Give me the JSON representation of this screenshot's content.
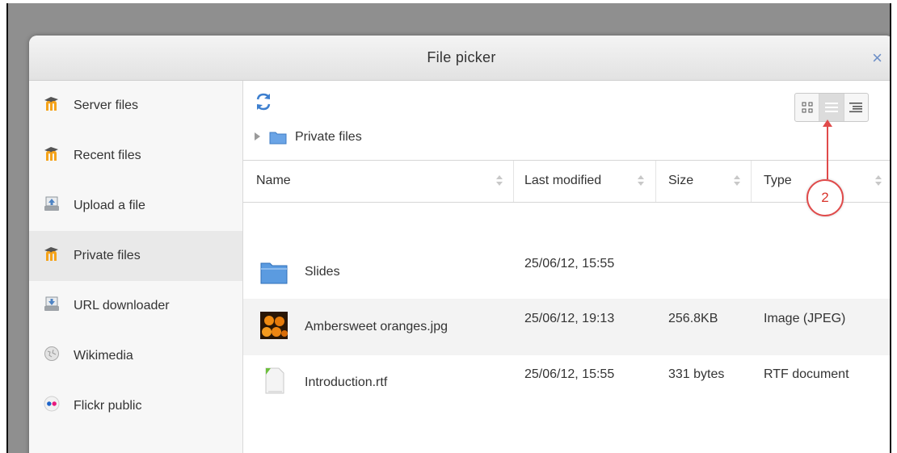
{
  "dialog": {
    "title": "File picker",
    "close_icon": "×"
  },
  "sidebar": {
    "items": [
      {
        "label": "Server files",
        "icon": "moodle-icon",
        "active": false
      },
      {
        "label": "Recent files",
        "icon": "moodle-icon",
        "active": false
      },
      {
        "label": "Upload a file",
        "icon": "upload-icon",
        "active": false
      },
      {
        "label": "Private files",
        "icon": "moodle-icon",
        "active": true
      },
      {
        "label": "URL downloader",
        "icon": "url-download-icon",
        "active": false
      },
      {
        "label": "Wikimedia",
        "icon": "wikimedia-icon",
        "active": false
      },
      {
        "label": "Flickr public",
        "icon": "flickr-icon",
        "active": false
      }
    ]
  },
  "toolbar": {
    "refresh_icon": "refresh-icon",
    "breadcrumb": "Private files",
    "view_modes": [
      "icons",
      "list",
      "tree"
    ],
    "active_view": "list"
  },
  "annotation": {
    "number": "2",
    "color": "#e04a4a"
  },
  "table": {
    "columns": [
      "Name",
      "Last modified",
      "Size",
      "Type"
    ],
    "rows": [
      {
        "name": "Slides",
        "modified": "25/06/12, 15:55",
        "size": "",
        "type": "",
        "icon": "folder-icon"
      },
      {
        "name": "Ambersweet oranges.jpg",
        "modified": "25/06/12, 19:13",
        "size": "256.8KB",
        "type": "Image (JPEG)",
        "icon": "image-thumbnail-icon"
      },
      {
        "name": "Introduction.rtf",
        "modified": "25/06/12, 15:55",
        "size": "331 bytes",
        "type": "RTF document",
        "icon": "document-icon"
      }
    ]
  },
  "colors": {
    "accent": "#6d8fc7",
    "folder": "#5b9be0",
    "moodle_orange": "#f5a31a"
  }
}
